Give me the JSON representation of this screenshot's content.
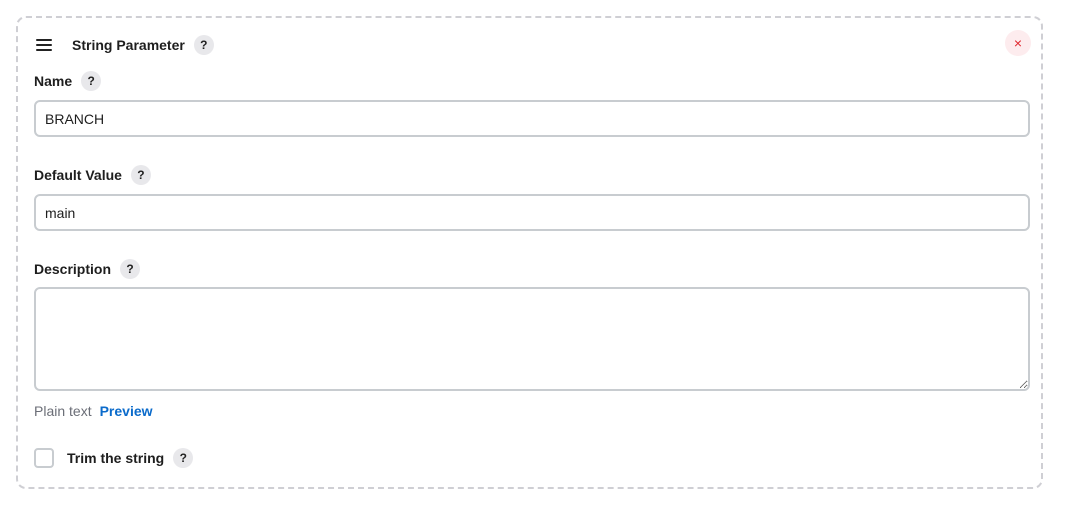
{
  "card": {
    "title": "String Parameter",
    "help": "?",
    "close_glyph": "×"
  },
  "fields": {
    "name": {
      "label": "Name",
      "help": "?",
      "value": "BRANCH"
    },
    "default_value": {
      "label": "Default Value",
      "help": "?",
      "value": "main"
    },
    "description": {
      "label": "Description",
      "help": "?",
      "value": ""
    }
  },
  "format": {
    "plain_text": "Plain text",
    "preview": "Preview"
  },
  "trim": {
    "label": "Trim the string",
    "help": "?",
    "checked": false
  },
  "icons": {
    "drag": "drag-handle-icon",
    "close": "close-icon",
    "help": "help-icon"
  },
  "colors": {
    "link": "#0b6bcb",
    "close": "#e0262e",
    "close_bg": "#fdecee",
    "border": "#c8ccd0"
  }
}
